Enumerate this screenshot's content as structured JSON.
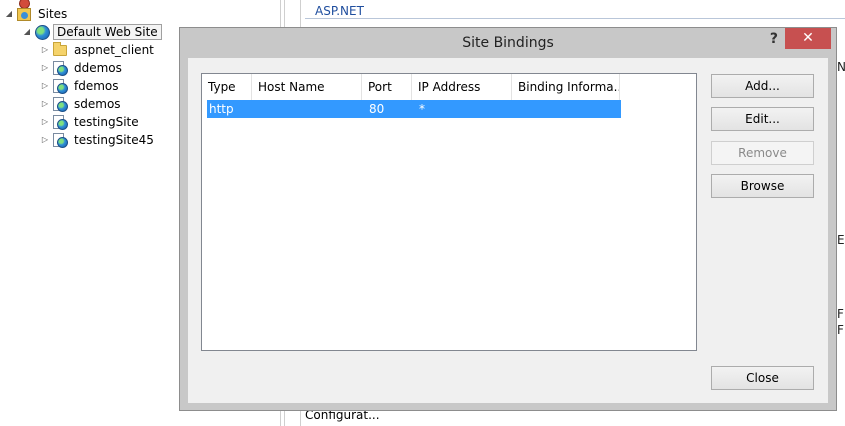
{
  "tree": {
    "sites_label": "Sites",
    "default_site_label": "Default Web Site",
    "children": [
      {
        "label": "aspnet_client",
        "icon": "folder-icon"
      },
      {
        "label": "ddemos",
        "icon": "web-app-icon"
      },
      {
        "label": "fdemos",
        "icon": "web-app-icon"
      },
      {
        "label": "sdemos",
        "icon": "web-app-icon"
      },
      {
        "label": "testingSite",
        "icon": "web-app-icon"
      },
      {
        "label": "testingSite45",
        "icon": "web-app-icon"
      }
    ]
  },
  "background": {
    "aspnet_header": "ASP.NET",
    "config_label": "Configurat...",
    "edge_chars": [
      "N",
      "Er",
      "F",
      "F"
    ]
  },
  "dialog": {
    "title": "Site Bindings",
    "help_label": "?",
    "close_label": "✕",
    "columns": [
      "Type",
      "Host Name",
      "Port",
      "IP Address",
      "Binding Informa..."
    ],
    "rows": [
      {
        "type": "http",
        "host_name": "",
        "port": "80",
        "ip_address": "*",
        "binding_info": ""
      }
    ],
    "buttons": {
      "add": "Add...",
      "edit": "Edit...",
      "remove": "Remove",
      "browse": "Browse",
      "close": "Close"
    }
  },
  "colors": {
    "selection": "#3399ff",
    "close_button": "#c75050",
    "aspnet_header": "#1f4e9e"
  }
}
